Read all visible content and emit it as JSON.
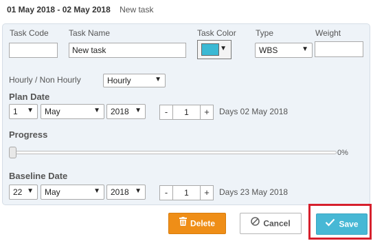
{
  "header": {
    "date_range": "01 May 2018 - 02 May 2018",
    "task_name": "New task"
  },
  "form": {
    "task_code": {
      "label": "Task Code",
      "value": ""
    },
    "task_name": {
      "label": "Task Name",
      "value": "New task"
    },
    "task_color": {
      "label": "Task Color",
      "color": "#3bb9d4"
    },
    "type": {
      "label": "Type",
      "value": "WBS"
    },
    "weight": {
      "label": "Weight",
      "value": ""
    },
    "hourly": {
      "label": "Hourly / Non Hourly",
      "value": "Hourly"
    },
    "plan_date": {
      "label": "Plan Date",
      "day": "1",
      "month": "May",
      "year": "2018",
      "minus": "-",
      "duration": "1",
      "plus": "+",
      "days_text": "Days 02 May 2018"
    },
    "progress": {
      "label": "Progress",
      "value_percent": 0,
      "value_text": "0%"
    },
    "baseline_date": {
      "label": "Baseline Date",
      "day": "22",
      "month": "May",
      "year": "2018",
      "minus": "-",
      "duration": "1",
      "plus": "+",
      "days_text": "Days 23 May 2018"
    }
  },
  "actions": {
    "delete_label": "Delete",
    "cancel_label": "Cancel",
    "save_label": "Save"
  },
  "icons": {
    "dropdown": "caret-down-icon",
    "delete": "trash-icon",
    "cancel": "ban-icon",
    "save": "check-icon"
  },
  "colors": {
    "panel_bg": "#eef3f8",
    "delete": "#ef8e17",
    "save": "#47b8d5",
    "highlight": "#d61f2c"
  }
}
